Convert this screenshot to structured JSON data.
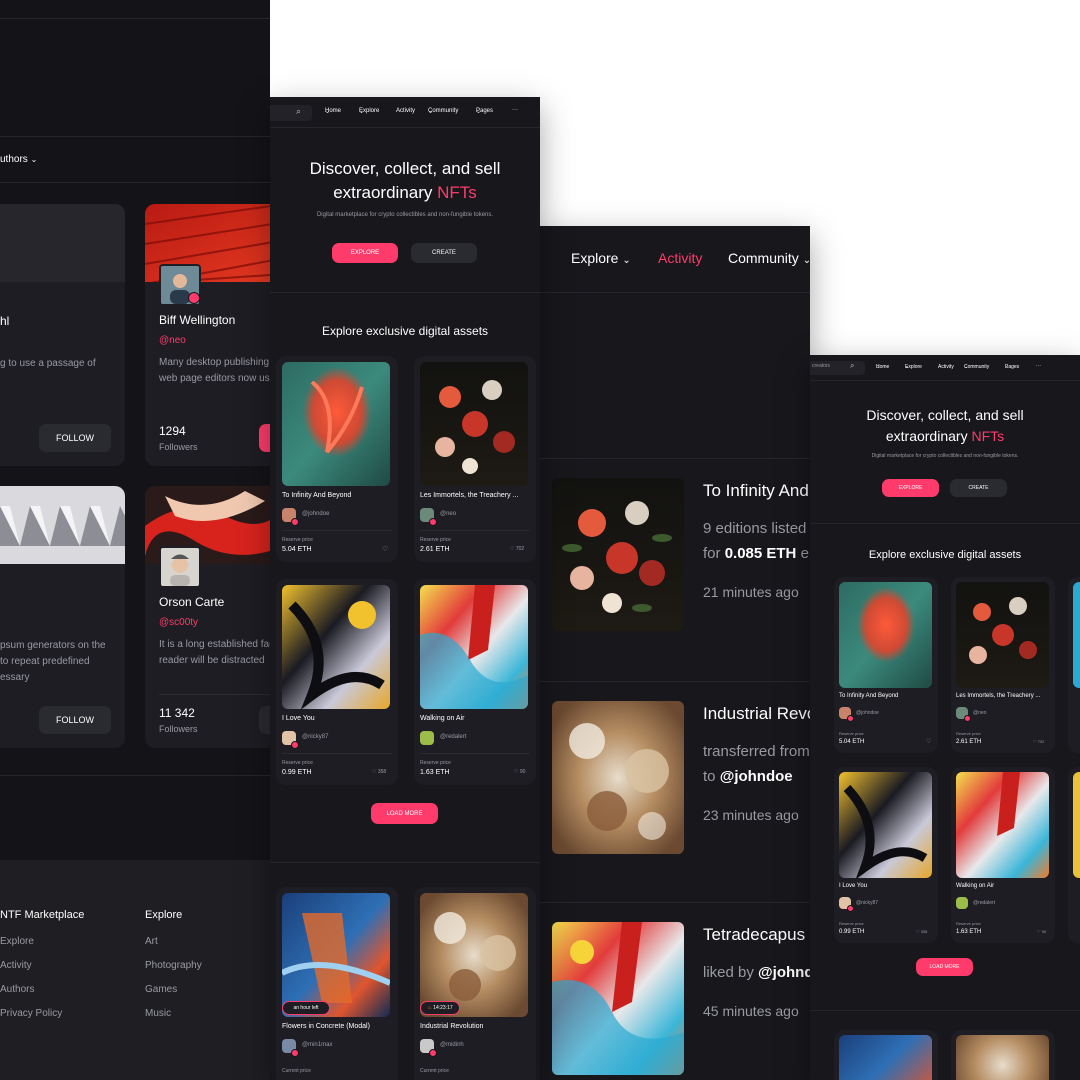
{
  "colors": {
    "accent": "#ff3b6b",
    "background": "#17171c",
    "card": "#1d1d23"
  },
  "authors_page": {
    "filter_label": "uthors",
    "creators": [
      {
        "name": "hl",
        "desc": [
          "g to use a passage of"
        ],
        "follow": "FOLLOW"
      },
      {
        "name": "Biff Wellington",
        "handle": "@neo",
        "desc": [
          "Many desktop publishing",
          "web page editors now use"
        ],
        "count": "1294",
        "count_label": "Followers"
      },
      {
        "desc": [
          "psum generators on the",
          "to repeat predefined",
          "essary"
        ],
        "follow": "FOLLOW"
      },
      {
        "name": "Orson Carte",
        "handle": "@sc00ty",
        "desc": [
          "It is a long established fac",
          "reader will be distracted"
        ],
        "count": "11 342",
        "count_label": "Followers"
      }
    ],
    "footer": {
      "col1_title": "NTF Marketplace",
      "col1": [
        "Explore",
        "Activity",
        "Authors",
        "Privacy Policy"
      ],
      "col2_title": "Explore",
      "col2": [
        "Art",
        "Photography",
        "Games",
        "Music"
      ]
    }
  },
  "nav": {
    "home": "Home",
    "explore": "Explore",
    "activity": "Activity",
    "community": "Community",
    "pages": "Pages",
    "more": "···",
    "search_placeholder": "creators"
  },
  "hero": {
    "title_line1": "Discover, collect, and sell",
    "title_line2_plain": "extraordinary ",
    "title_line2_accent": "NFTs",
    "subtitle": "Digital marketplace for crypto collectibles and non-fungible tokens.",
    "explore_btn": "EXPLORE",
    "create_btn": "CREATE"
  },
  "section_title": "Explore exclusive digital assets",
  "items": [
    {
      "title": "To Infinity And Beyond",
      "user": "@johndoe",
      "price_label": "Reserve price",
      "price": "5.04 ETH",
      "likes": ""
    },
    {
      "title": "Les Immortels, the Treachery ...",
      "user": "@neo",
      "price_label": "Reserve price",
      "price": "2.61 ETH",
      "likes": "702"
    },
    {
      "title": "I Love You",
      "user": "@nicky87",
      "price_label": "Reserve price",
      "price": "0.99 ETH",
      "likes": "358"
    },
    {
      "title": "Walking on Air",
      "user": "@redalert",
      "price_label": "Reserve price",
      "price": "1.63 ETH",
      "likes": "90"
    },
    {
      "title": "Flowers in Concrete (Modal)",
      "user": "@min1max",
      "price_label": "Current price",
      "badge": "an hour left"
    },
    {
      "title": "Industrial Revolution",
      "user": "@midinh",
      "price_label": "Current price",
      "badge": "14:23:17"
    }
  ],
  "load_more": "LOAD MORE",
  "activity": {
    "nav": {
      "explore": "Explore",
      "activity": "Activity",
      "community": "Community"
    },
    "entries": [
      {
        "title": "To Infinity And",
        "line1": "9 editions listed",
        "line2_prefix": "for ",
        "line2_bold": "0.085 ETH",
        "line2_suffix": " e",
        "time": "21 minutes ago"
      },
      {
        "title": "Industrial Revo",
        "line1": "transferred from",
        "line2_prefix": "to ",
        "line2_bold": "@johndoe",
        "line2_suffix": "",
        "time": "23 minutes ago"
      },
      {
        "title": "Tetradecapus",
        "line1": "liked by ",
        "line1_bold": "@johnd",
        "time": "45 minutes ago"
      }
    ]
  }
}
